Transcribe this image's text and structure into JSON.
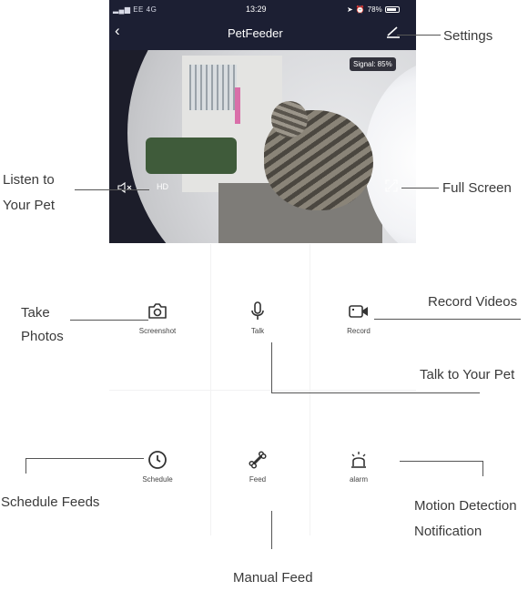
{
  "status_bar": {
    "carrier": "EE",
    "network": "4G",
    "time": "13:29",
    "battery": "78%"
  },
  "header": {
    "title": "PetFeeder",
    "back_icon": "chevron-left-icon",
    "settings_icon": "edit-icon"
  },
  "video": {
    "signal_text": "Signal: 85%",
    "quality_label": "HD",
    "mute_icon": "speaker-mute-icon",
    "fullscreen_icon": "fullscreen-icon"
  },
  "controls": [
    {
      "label": "Screenshot",
      "icon": "camera-icon"
    },
    {
      "label": "Talk",
      "icon": "microphone-icon"
    },
    {
      "label": "Record",
      "icon": "video-camera-icon"
    },
    {
      "label": "Schedule",
      "icon": "clock-icon"
    },
    {
      "label": "Feed",
      "icon": "bone-icon"
    },
    {
      "label": "alarm",
      "icon": "alarm-icon"
    }
  ],
  "callouts": {
    "settings": "Settings",
    "listen_line1": "Listen to",
    "listen_line2": "Your Pet",
    "full_screen": "Full Screen",
    "take_photos_line1": "Take",
    "take_photos_line2": "Photos",
    "record_videos": "Record Videos",
    "talk_to_pet": "Talk to Your Pet",
    "schedule_feeds": "Schedule Feeds",
    "motion_line1": "Motion Detection",
    "motion_line2": "Notification",
    "manual_feed": "Manual Feed"
  },
  "colors": {
    "header_bg": "#1c1f33",
    "video_bg": "#1c1d2a",
    "icon": "#333333"
  }
}
